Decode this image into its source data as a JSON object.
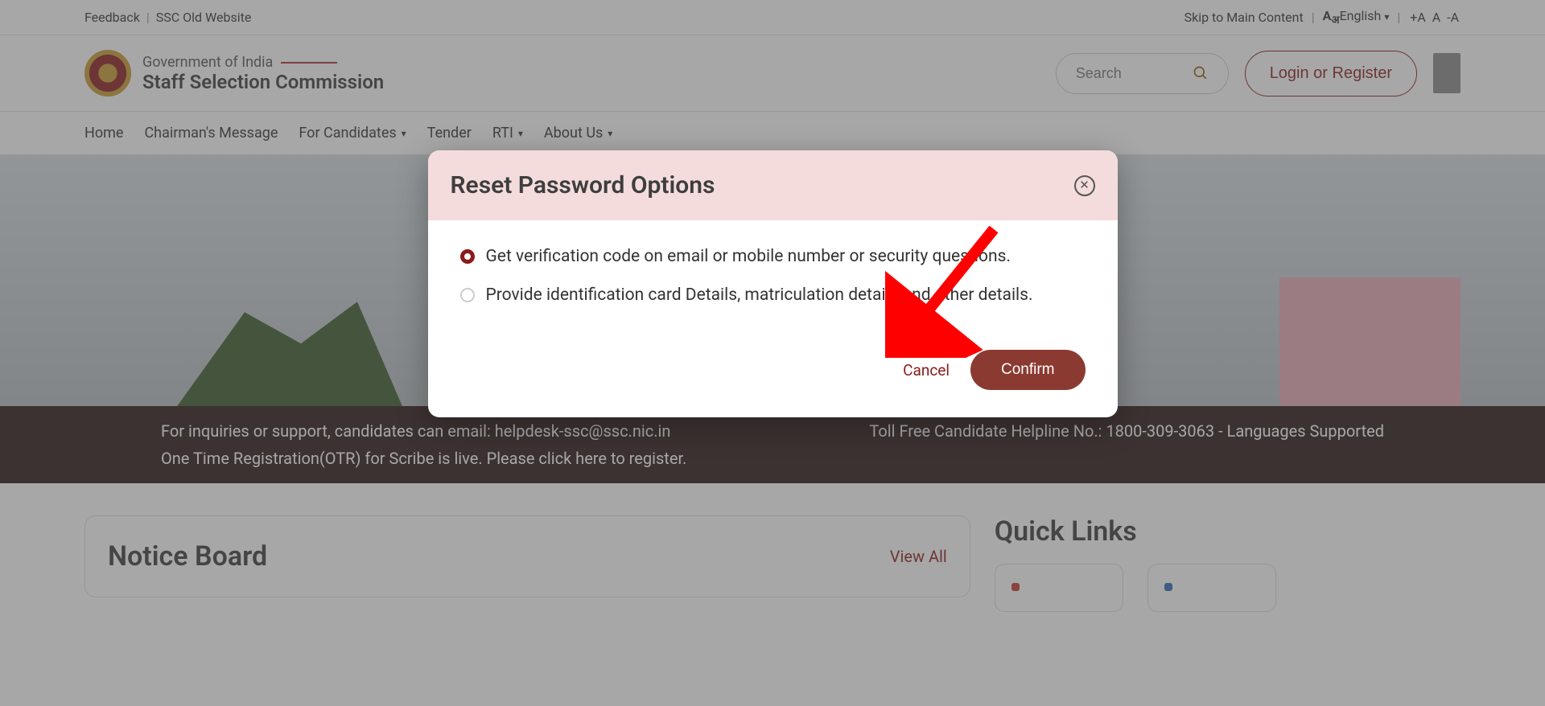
{
  "top_bar": {
    "feedback": "Feedback",
    "old_site": "SSC Old Website",
    "skip": "Skip to Main Content",
    "language_label": "English",
    "font_increase": "+A",
    "font_normal": "A",
    "font_decrease": "-A"
  },
  "header": {
    "gov_label": "Government of India",
    "org_name": "Staff Selection Commission",
    "search_placeholder": "Search",
    "login_label": "Login or Register"
  },
  "nav": {
    "items": [
      {
        "label": "Home",
        "dropdown": false
      },
      {
        "label": "Chairman's Message",
        "dropdown": false
      },
      {
        "label": "For Candidates",
        "dropdown": true
      },
      {
        "label": "Tender",
        "dropdown": false
      },
      {
        "label": "RTI",
        "dropdown": true
      },
      {
        "label": "About Us",
        "dropdown": true
      }
    ]
  },
  "ticker": {
    "line1_left": "For inquiries or support, candidates can email: helpdesk-ssc@ssc.nic.in",
    "line1_right": "Toll Free Candidate Helpline No.: 1800-309-3063 - Languages Supported",
    "line2": "One Time Registration(OTR) for Scribe is live. Please click here to register."
  },
  "notice": {
    "title": "Notice Board",
    "view_all": "View All"
  },
  "quick_links": {
    "title": "Quick Links"
  },
  "modal": {
    "title": "Reset Password Options",
    "option1": "Get verification code on email or mobile number or security questions.",
    "option2": "Provide identification card Details, matriculation details and other details.",
    "cancel": "Cancel",
    "confirm": "Confirm"
  }
}
